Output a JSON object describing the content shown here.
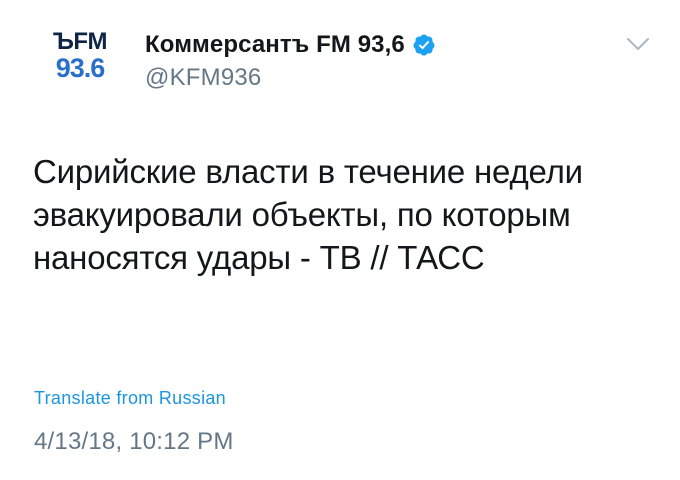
{
  "author": {
    "avatar": {
      "logo_line1": "ЪFM",
      "logo_line2": "93.6"
    },
    "display_name": "Коммерсантъ FM 93,6",
    "handle": "@KFM936",
    "verified": true
  },
  "menu": {
    "icon": "chevron-down-icon"
  },
  "tweet": {
    "text": "Сирийские власти в течение недели эвакуировали объекты, по которым наносятся удары - ТВ // ТАСС",
    "translate_label": "Translate from Russian",
    "timestamp": "4/13/18, 10:12 PM"
  },
  "colors": {
    "accent": "#1b95e0",
    "secondary_text": "#657786",
    "logo_dark": "#0f2447",
    "logo_blue": "#2a6fc9"
  }
}
